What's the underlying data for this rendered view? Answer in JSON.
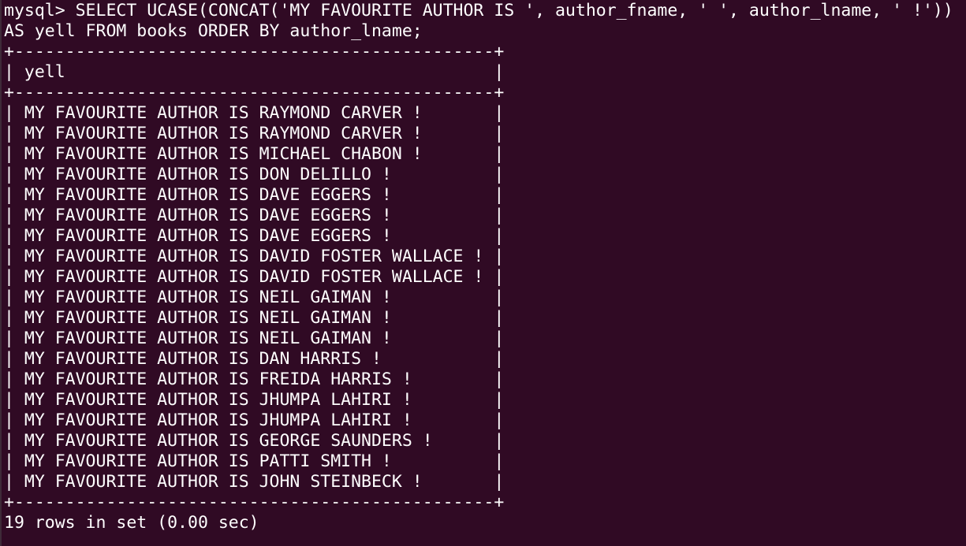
{
  "terminal": {
    "prompt": "mysql> ",
    "command_line_1": "SELECT UCASE(CONCAT('MY FAVOURITE AUTHOR IS ', author_fname, ' ', author_lname, ' !'))",
    "command_line_2": "AS yell FROM books ORDER BY author_lname;"
  },
  "result_table": {
    "border": "+-----------------------------------------------+",
    "header": "| yell                                          |",
    "rows": [
      "| MY FAVOURITE AUTHOR IS RAYMOND CARVER !       |",
      "| MY FAVOURITE AUTHOR IS RAYMOND CARVER !       |",
      "| MY FAVOURITE AUTHOR IS MICHAEL CHABON !       |",
      "| MY FAVOURITE AUTHOR IS DON DELILLO !          |",
      "| MY FAVOURITE AUTHOR IS DAVE EGGERS !          |",
      "| MY FAVOURITE AUTHOR IS DAVE EGGERS !          |",
      "| MY FAVOURITE AUTHOR IS DAVE EGGERS !          |",
      "| MY FAVOURITE AUTHOR IS DAVID FOSTER WALLACE ! |",
      "| MY FAVOURITE AUTHOR IS DAVID FOSTER WALLACE ! |",
      "| MY FAVOURITE AUTHOR IS NEIL GAIMAN !          |",
      "| MY FAVOURITE AUTHOR IS NEIL GAIMAN !          |",
      "| MY FAVOURITE AUTHOR IS NEIL GAIMAN !          |",
      "| MY FAVOURITE AUTHOR IS DAN HARRIS !           |",
      "| MY FAVOURITE AUTHOR IS FREIDA HARRIS !        |",
      "| MY FAVOURITE AUTHOR IS JHUMPA LAHIRI !        |",
      "| MY FAVOURITE AUTHOR IS JHUMPA LAHIRI !        |",
      "| MY FAVOURITE AUTHOR IS GEORGE SAUNDERS !      |",
      "| MY FAVOURITE AUTHOR IS PATTI SMITH !          |",
      "| MY FAVOURITE AUTHOR IS JOHN STEINBECK !       |"
    ],
    "summary": "19 rows in set (0.00 sec)"
  },
  "colors": {
    "background": "#300a24",
    "text": "#ffffff"
  }
}
